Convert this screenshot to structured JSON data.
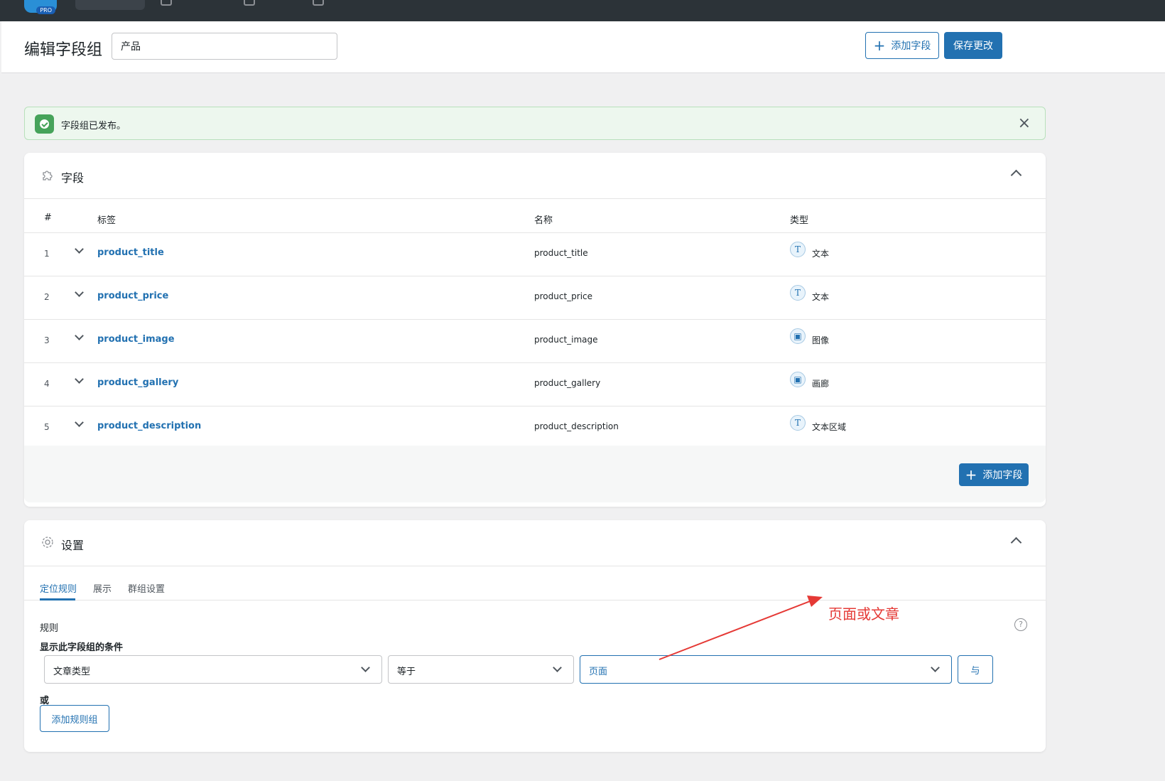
{
  "topbar": {
    "pro_badge": "PRO"
  },
  "header": {
    "title": "编辑字段组",
    "group_name_value": "产品",
    "add_field_label": "添加字段",
    "save_label": "保存更改"
  },
  "notice": {
    "message": "字段组已发布。",
    "close_glyph": "×"
  },
  "fields_panel": {
    "title": "字段",
    "columns": [
      "#",
      "标签",
      "名称",
      "类型"
    ],
    "rows": [
      {
        "num": "1",
        "label": "product_title",
        "name": "product_title",
        "type": "文本",
        "type_icon": "text-type-icon",
        "glyph": "T"
      },
      {
        "num": "2",
        "label": "product_price",
        "name": "product_price",
        "type": "文本",
        "type_icon": "text-type-icon",
        "glyph": "T"
      },
      {
        "num": "3",
        "label": "product_image",
        "name": "product_image",
        "type": "图像",
        "type_icon": "image-type-icon",
        "glyph": "▣"
      },
      {
        "num": "4",
        "label": "product_gallery",
        "name": "product_gallery",
        "type": "画廊",
        "type_icon": "gallery-type-icon",
        "glyph": "▣"
      },
      {
        "num": "5",
        "label": "product_description",
        "name": "product_description",
        "type": "文本区域",
        "type_icon": "textarea-type-icon",
        "glyph": "T"
      }
    ],
    "add_field_label": "添加字段"
  },
  "settings_panel": {
    "title": "设置",
    "tabs": [
      "定位规则",
      "展示",
      "群组设置"
    ],
    "rules_label": "规则",
    "condition_label": "显示此字段组的条件",
    "rule": {
      "param": "文章类型",
      "operator": "等于",
      "value": "页面"
    },
    "and_label": "与",
    "or_label": "或",
    "add_rule_group_label": "添加规则组",
    "help_glyph": "?"
  },
  "annotation": {
    "text": "页面或文章",
    "color": "#e53935"
  },
  "colors": {
    "primary": "#2271b1",
    "success": "#46a35a",
    "notice_bg": "#edf7ee",
    "topbar": "#2c3338"
  }
}
